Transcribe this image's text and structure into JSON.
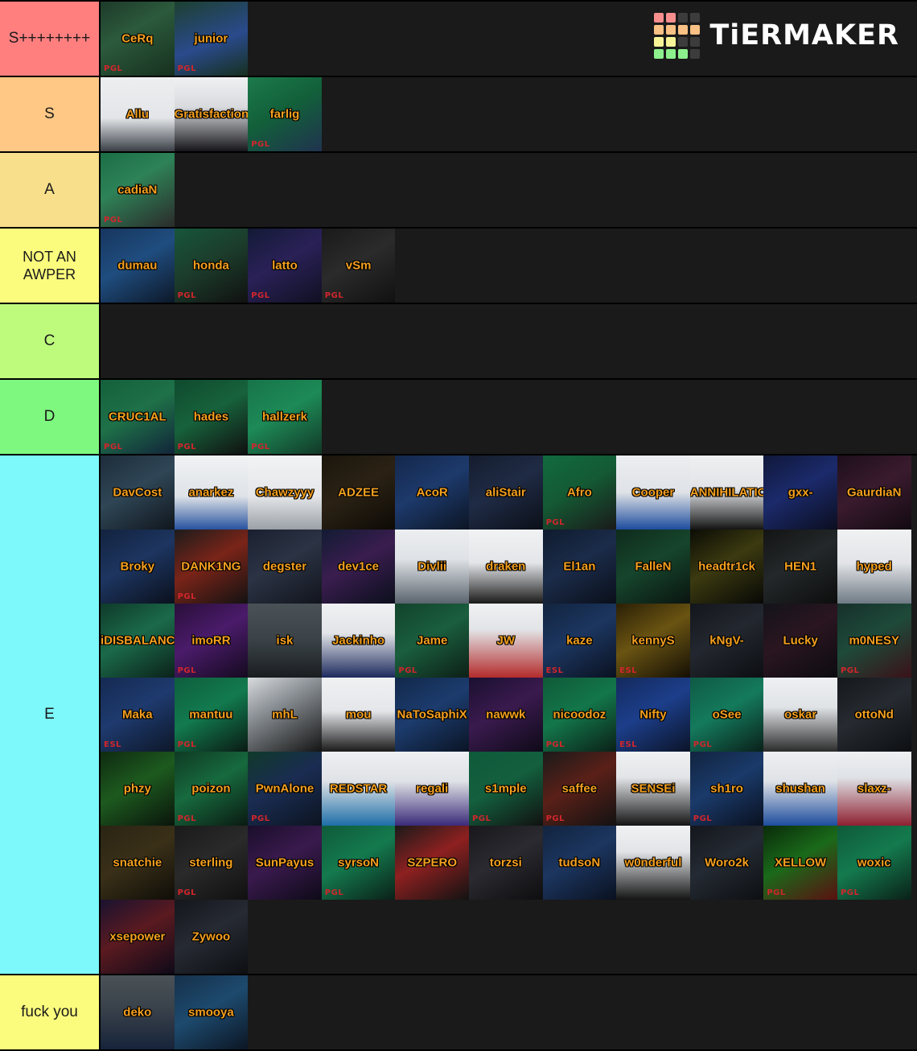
{
  "app": {
    "name": "TierMaker",
    "logo_word": "TiERMAKER",
    "logo_colors": [
      "#f98e8e",
      "#f98e8e",
      "#3c3c3c",
      "#3c3c3c",
      "#f9c184",
      "#f9c184",
      "#f9c184",
      "#f9c184",
      "#f7f497",
      "#f7f497",
      "#3c3c3c",
      "#3c3c3c",
      "#8cf08c",
      "#8cf08c",
      "#8cf08c",
      "#3c3c3c"
    ],
    "background": "#1a1a1a"
  },
  "accent": {
    "caption_color": "#f5a01e",
    "watermark_text": "PGL",
    "watermark_color": "#d2262c"
  },
  "tiers": [
    {
      "label": "S++++++++",
      "color": "#ff7f7f",
      "items": [
        {
          "name": "CeRq",
          "bg": "linear-gradient(150deg,#1d3a2a 0%,#2c5a3c 40%,#16301f 100%)",
          "watermark": "PGL"
        },
        {
          "name": "junior",
          "bg": "linear-gradient(160deg,#1d4030 0%,#2a4a8c 55%,#16301f 100%)",
          "watermark": "PGL"
        }
      ]
    },
    {
      "label": "S",
      "color": "#ffc885",
      "items": [
        {
          "name": "Allu",
          "bg": "linear-gradient(180deg,#eceef0 0%,#e3e5e8 55%,#3a3f47 100%)",
          "watermark": ""
        },
        {
          "name": "Gratisfaction",
          "bg": "linear-gradient(180deg,#f0f1f3 0%,#d8dade 40%,#16161a 100%)",
          "watermark": ""
        },
        {
          "name": "farlig",
          "bg": "linear-gradient(150deg,#1c7a4a 0%,#12603a 45%,#20334f 100%)",
          "watermark": "PGL"
        }
      ]
    },
    {
      "label": "A",
      "color": "#f7df8b",
      "items": [
        {
          "name": "cadiaN",
          "bg": "linear-gradient(150deg,#1b6d46 0%,#2e8257 40%,#2b2b2b 100%)",
          "watermark": "PGL"
        }
      ]
    },
    {
      "label": "NOT AN AWPER",
      "color": "#fbfb7d",
      "items": [
        {
          "name": "dumau",
          "bg": "linear-gradient(150deg,#17365e 0%,#1f4d7f 45%,#0d1828 100%)",
          "watermark": ""
        },
        {
          "name": "honda",
          "bg": "linear-gradient(150deg,#17563a 0%,#1c3d2c 45%,#111111 100%)",
          "watermark": "PGL"
        },
        {
          "name": "latto",
          "bg": "linear-gradient(150deg,#131a36 0%,#2a2157 45%,#101022 100%)",
          "watermark": "PGL"
        },
        {
          "name": "vSm",
          "bg": "linear-gradient(150deg,#1a1a1a 0%,#2b2b2b 45%,#111111 100%)",
          "watermark": "PGL"
        }
      ]
    },
    {
      "label": "C",
      "color": "#befb7d",
      "items": []
    },
    {
      "label": "D",
      "color": "#7ef87e",
      "items": [
        {
          "name": "CRUC1AL",
          "bg": "linear-gradient(150deg,#14603c 0%,#1e7148 45%,#12243a 100%)",
          "watermark": "PGL"
        },
        {
          "name": "hades",
          "bg": "linear-gradient(150deg,#0f4a2e 0%,#17623c 45%,#101010 100%)",
          "watermark": "PGL"
        },
        {
          "name": "hallzerk",
          "bg": "linear-gradient(150deg,#17744a 0%,#1d8a57 45%,#123827 100%)",
          "watermark": "PGL"
        }
      ]
    },
    {
      "label": "E",
      "color": "#7df9fb",
      "items": [
        {
          "name": "DavCost",
          "bg": "linear-gradient(150deg,#1d2c3a 0%,#2f4656 45%,#10161d 100%)",
          "watermark": ""
        },
        {
          "name": "anarkez",
          "bg": "linear-gradient(180deg,#f0f2f4 0%,#dfe3e7 55%,#2752a0 100%)",
          "watermark": ""
        },
        {
          "name": "Chawzyyy",
          "bg": "linear-gradient(180deg,#f2f3f5 0%,#e4e6e9 55%,#9aa0a6 100%)",
          "watermark": ""
        },
        {
          "name": "ADZEE",
          "bg": "linear-gradient(150deg,#1a150c 0%,#2b2214 45%,#0d0a06 100%)",
          "watermark": ""
        },
        {
          "name": "AcoR",
          "bg": "linear-gradient(150deg,#14274a 0%,#1d3a6c 45%,#0c1524 100%)",
          "watermark": ""
        },
        {
          "name": "aliStair",
          "bg": "linear-gradient(150deg,#151d2e 0%,#1f2b45 45%,#0b0f18 100%)",
          "watermark": ""
        },
        {
          "name": "Afro",
          "bg": "linear-gradient(150deg,#116a3d 0%,#145a34 45%,#1a1a1a 100%)",
          "watermark": "PGL"
        },
        {
          "name": "Cooper",
          "bg": "linear-gradient(180deg,#eceef1 0%,#dfe2e6 50%,#1d4c9e 100%)",
          "watermark": ""
        },
        {
          "name": "ANNIHILATION",
          "bg": "linear-gradient(180deg,#eff0f2 0%,#e1e3e6 45%,#141414 100%)",
          "watermark": ""
        },
        {
          "name": "gxx-",
          "bg": "linear-gradient(150deg,#10183a 0%,#1b2a6b 45%,#0b0e1f 100%)",
          "watermark": ""
        },
        {
          "name": "GaurdiaN",
          "bg": "linear-gradient(150deg,#1d0f1c 0%,#3a1b2e 45%,#120a12 100%)",
          "watermark": ""
        },
        {
          "name": "Broky",
          "bg": "linear-gradient(150deg,#13233f 0%,#1d3560 45%,#0a101c 100%)",
          "watermark": ""
        },
        {
          "name": "DANK1NG",
          "bg": "linear-gradient(150deg,#1c1c1c 0%,#7a2418 45%,#121212 100%)",
          "watermark": "PGL"
        },
        {
          "name": "degster",
          "bg": "linear-gradient(150deg,#1b2030 0%,#2b3344 45%,#11141c 100%)",
          "watermark": ""
        },
        {
          "name": "dev1ce",
          "bg": "linear-gradient(150deg,#121b33 0%,#3a1d4f 45%,#0b0f1c 100%)",
          "watermark": ""
        },
        {
          "name": "Divlii",
          "bg": "linear-gradient(180deg,#eceef0 0%,#dfe2e6 40%,#5a646e 100%)",
          "watermark": ""
        },
        {
          "name": "draken",
          "bg": "linear-gradient(180deg,#f1f2f4 0%,#e3e5e8 45%,#1a1a1a 100%)",
          "watermark": ""
        },
        {
          "name": "El1an",
          "bg": "linear-gradient(150deg,#0f1b2e 0%,#1b2c4a 45%,#0a0f1a 100%)",
          "watermark": ""
        },
        {
          "name": "FalleN",
          "bg": "linear-gradient(150deg,#0f2b1c 0%,#16452c 45%,#0a1410 100%)",
          "watermark": ""
        },
        {
          "name": "headtr1ck",
          "bg": "linear-gradient(150deg,#0c0c06 0%,#3b3a10 45%,#080806 100%)",
          "watermark": ""
        },
        {
          "name": "HEN1",
          "bg": "linear-gradient(150deg,#141414 0%,#23282a 45%,#0d0d0d 100%)",
          "watermark": ""
        },
        {
          "name": "hyped",
          "bg": "linear-gradient(180deg,#f0f1f3 0%,#e2e4e7 45%,#6e7a84 100%)",
          "watermark": ""
        },
        {
          "name": "iDISBALANCE",
          "bg": "linear-gradient(150deg,#0f3a2a 0%,#1b6a4a 45%,#0b211a 100%)",
          "watermark": ""
        },
        {
          "name": "imoRR",
          "bg": "linear-gradient(150deg,#2a0f3a 0%,#4a1b6a 45%,#150a1f 100%)",
          "watermark": "PGL"
        },
        {
          "name": "isk",
          "bg": "linear-gradient(180deg,#4a5257 0%,#3a4247 50%,#1a1d20 100%)",
          "watermark": ""
        },
        {
          "name": "Jackinho",
          "bg": "linear-gradient(180deg,#f0f1f3 0%,#e2e4e7 40%,#1d2a5e 100%)",
          "watermark": ""
        },
        {
          "name": "Jame",
          "bg": "linear-gradient(150deg,#12432c 0%,#1a5e3e 45%,#0d1f16 100%)",
          "watermark": "PGL"
        },
        {
          "name": "JW",
          "bg": "linear-gradient(180deg,#f0f1f3 0%,#e2e4e7 35%,#b42b2b 100%)",
          "watermark": ""
        },
        {
          "name": "kaze",
          "bg": "linear-gradient(150deg,#12243f 0%,#1c3660 45%,#0a1120 100%)",
          "watermark": "ESL"
        },
        {
          "name": "kennyS",
          "bg": "linear-gradient(150deg,#2a1f06 0%,#6a5412 45%,#140f05 100%)",
          "watermark": "ESL"
        },
        {
          "name": "kNgV-",
          "bg": "linear-gradient(150deg,#13161c 0%,#23272f 45%,#0c0e12 100%)",
          "watermark": ""
        },
        {
          "name": "Lucky",
          "bg": "linear-gradient(150deg,#14141a 0%,#2a1520 45%,#0c0c10 100%)",
          "watermark": ""
        },
        {
          "name": "m0NESY",
          "bg": "linear-gradient(150deg,#16302a 0%,#1e4a3a 45%,#3a1118 100%)",
          "watermark": "PGL"
        },
        {
          "name": "Maka",
          "bg": "linear-gradient(150deg,#152a52 0%,#1e3a6e 45%,#0d1728 100%)",
          "watermark": "ESL"
        },
        {
          "name": "mantuu",
          "bg": "linear-gradient(150deg,#0e5e3d 0%,#127a4e 45%,#0a1a14 100%)",
          "watermark": "PGL"
        },
        {
          "name": "mhL",
          "bg": "linear-gradient(150deg,#d9dbdd 0%,#8e9499 35%,#141414 100%)",
          "watermark": ""
        },
        {
          "name": "mou",
          "bg": "linear-gradient(180deg,#f0f1f3 0%,#e4e6e9 45%,#1a1a1a 100%)",
          "watermark": ""
        },
        {
          "name": "NaToSaphiX",
          "bg": "linear-gradient(150deg,#12284a 0%,#1c3c6e 45%,#0a1424 100%)",
          "watermark": ""
        },
        {
          "name": "nawwk",
          "bg": "linear-gradient(150deg,#1a1030 0%,#3a1a4e 45%,#0e0a18 100%)",
          "watermark": ""
        },
        {
          "name": "nicoodoz",
          "bg": "linear-gradient(150deg,#0f5a38 0%,#13764a 45%,#0a2018 100%)",
          "watermark": "PGL"
        },
        {
          "name": "Nifty",
          "bg": "linear-gradient(150deg,#142a5e 0%,#1c3e8a 45%,#0b1428 100%)",
          "watermark": "ESL"
        },
        {
          "name": "oSee",
          "bg": "linear-gradient(150deg,#0f5a44 0%,#147a5c 45%,#0a201a 100%)",
          "watermark": "PGL"
        },
        {
          "name": "oskar",
          "bg": "linear-gradient(180deg,#eef0f2 0%,#e0e3e6 40%,#2b2b2b 100%)",
          "watermark": ""
        },
        {
          "name": "ottoNd",
          "bg": "linear-gradient(150deg,#15181c 0%,#262b31 45%,#0d0f12 100%)",
          "watermark": ""
        },
        {
          "name": "phzy",
          "bg": "linear-gradient(150deg,#0f2a10 0%,#1d5a1f 45%,#0a140b 100%)",
          "watermark": ""
        },
        {
          "name": "poizon",
          "bg": "linear-gradient(150deg,#0f3a24 0%,#176a3e 45%,#0a1a12 100%)",
          "watermark": "PGL"
        },
        {
          "name": "PwnAlone",
          "bg": "linear-gradient(150deg,#103a2a 0%,#1a2c52 45%,#0c1420 100%)",
          "watermark": "PGL"
        },
        {
          "name": "REDSTAR",
          "bg": "linear-gradient(180deg,#eef0f2 0%,#dfe2e6 40%,#1d6ea8 100%)",
          "watermark": ""
        },
        {
          "name": "regali",
          "bg": "linear-gradient(180deg,#eef0f2 0%,#dfe2e6 40%,#3b2a7a 100%)",
          "watermark": ""
        },
        {
          "name": "s1mple",
          "bg": "linear-gradient(150deg,#0e5a3a 0%,#135f3e 45%,#111111 100%)",
          "watermark": "PGL"
        },
        {
          "name": "saffee",
          "bg": "linear-gradient(150deg,#1a1a1a 0%,#5a2018 45%,#121212 100%)",
          "watermark": "PGL"
        },
        {
          "name": "SENSEi",
          "bg": "linear-gradient(180deg,#f0f1f3 0%,#e2e4e7 35%,#141414 100%)",
          "watermark": ""
        },
        {
          "name": "sh1ro",
          "bg": "linear-gradient(150deg,#12243f 0%,#1a3a6a 45%,#0a1120 100%)",
          "watermark": "PGL"
        },
        {
          "name": "shushan",
          "bg": "linear-gradient(180deg,#eef0f2 0%,#dfe2e6 40%,#1d4c9e 100%)",
          "watermark": ""
        },
        {
          "name": "slaxz-",
          "bg": "linear-gradient(180deg,#eef0f2 0%,#dfe2e6 35%,#8e2030 100%)",
          "watermark": ""
        },
        {
          "name": "snatchie",
          "bg": "linear-gradient(150deg,#2a2414 0%,#3a3018 45%,#0f0d08 100%)",
          "watermark": ""
        },
        {
          "name": "sterling",
          "bg": "linear-gradient(150deg,#1a1a1a 0%,#2a2a2a 45%,#101010 100%)",
          "watermark": "PGL"
        },
        {
          "name": "SunPayus",
          "bg": "linear-gradient(150deg,#1a0e2a 0%,#3a1a4e 45%,#0e0a18 100%)",
          "watermark": ""
        },
        {
          "name": "syrsoN",
          "bg": "linear-gradient(150deg,#0f5a3a 0%,#147a4e 45%,#0a2018 100%)",
          "watermark": "PGL"
        },
        {
          "name": "SZPERO",
          "bg": "linear-gradient(150deg,#1a1a1a 0%,#8e2020 45%,#121212 100%)",
          "watermark": ""
        },
        {
          "name": "torzsi",
          "bg": "linear-gradient(150deg,#18181c 0%,#2a2a30 45%,#0e0e10 100%)",
          "watermark": ""
        },
        {
          "name": "tudsoN",
          "bg": "linear-gradient(150deg,#12243f 0%,#1c3660 45%,#0a1120 100%)",
          "watermark": ""
        },
        {
          "name": "w0nderful",
          "bg": "linear-gradient(180deg,#f0f1f3 0%,#e2e4e7 35%,#141414 100%)",
          "watermark": ""
        },
        {
          "name": "Woro2k",
          "bg": "linear-gradient(150deg,#14161c 0%,#242a33 45%,#0d0f12 100%)",
          "watermark": ""
        },
        {
          "name": "XELLOW",
          "bg": "linear-gradient(150deg,#0a2a0a 0%,#1a6a1a 45%,#5a1010 100%)",
          "watermark": "PGL"
        },
        {
          "name": "woxic",
          "bg": "linear-gradient(150deg,#0f5a3a 0%,#147a4e 45%,#0a2018 100%)",
          "watermark": "PGL"
        },
        {
          "name": "xsepower",
          "bg": "linear-gradient(150deg,#1a1230 0%,#5a1a20 45%,#0e0a18 100%)",
          "watermark": ""
        },
        {
          "name": "Zywoo",
          "bg": "linear-gradient(150deg,#14161c 0%,#262a33 45%,#0d0f12 100%)",
          "watermark": ""
        }
      ]
    },
    {
      "label": "fuck you",
      "color": "#fbfb7d",
      "items": [
        {
          "name": "deko",
          "bg": "linear-gradient(180deg,#4a5257 0%,#39414a 45%,#16233a 100%)",
          "watermark": ""
        },
        {
          "name": "smooya",
          "bg": "linear-gradient(150deg,#16304a 0%,#1d4a6e 45%,#0c1624 100%)",
          "watermark": ""
        }
      ]
    }
  ]
}
